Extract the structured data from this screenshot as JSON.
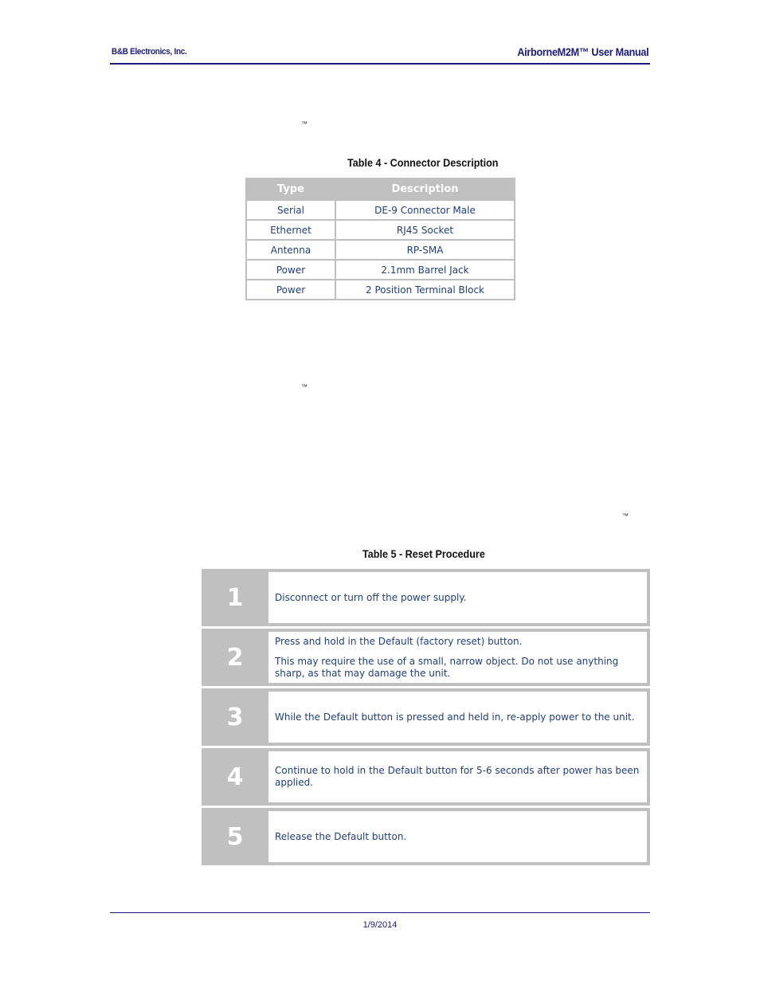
{
  "header": {
    "company": "B&B Electronics, Inc.",
    "manual_title": "AirborneM2M™ User Manual"
  },
  "trademarks": [
    "™",
    "™",
    "™"
  ],
  "table4": {
    "caption": "Table 4 - Connector Description",
    "headers": [
      "Type",
      "Description"
    ],
    "rows": [
      [
        "Serial",
        "DE-9 Connector Male"
      ],
      [
        "Ethernet",
        "RJ45 Socket"
      ],
      [
        "Antenna",
        "RP-SMA"
      ],
      [
        "Power",
        "2.1mm Barrel Jack"
      ],
      [
        "Power",
        "2 Position Terminal Block"
      ]
    ]
  },
  "table5": {
    "caption": "Table 5 - Reset Procedure",
    "steps": [
      {
        "number": "1",
        "lines": [
          "Disconnect or turn off the power supply."
        ]
      },
      {
        "number": "2",
        "lines": [
          "Press and hold in the Default (factory reset) button.",
          "This may require the use of a small, narrow object.  Do not use anything sharp, as that may damage the unit."
        ]
      },
      {
        "number": "3",
        "lines": [
          "While the Default button is pressed and held in, re-apply power to the unit."
        ]
      },
      {
        "number": "4",
        "lines": [
          "Continue to hold in the Default button for 5-6 seconds after power has been applied."
        ]
      },
      {
        "number": "5",
        "lines": [
          "Release the Default button."
        ]
      }
    ]
  },
  "footer": {
    "date": "1/9/2014"
  }
}
